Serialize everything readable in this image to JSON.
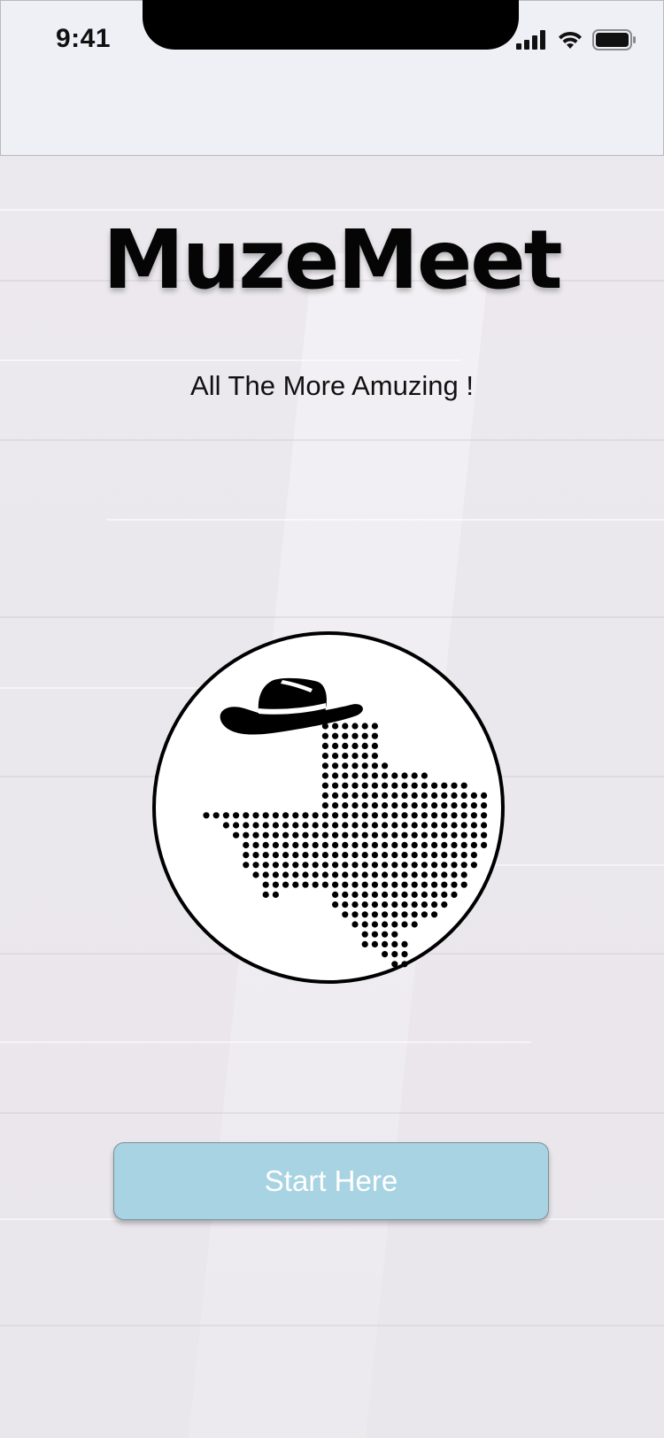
{
  "status_bar": {
    "time": "9:41",
    "icons": [
      "cellular-signal-icon",
      "wifi-icon",
      "battery-icon"
    ]
  },
  "app": {
    "title": "MuzeMeet",
    "tagline": "All The More Amuzing !",
    "logo_icon": "texas-cowboy-hat-logo-icon"
  },
  "start_button": {
    "label": "Start Here",
    "color": "#a8d3e2"
  },
  "colors": {
    "header_bg": "#efeff6",
    "page_bg": "#ebe8ee",
    "title": "#050505"
  }
}
